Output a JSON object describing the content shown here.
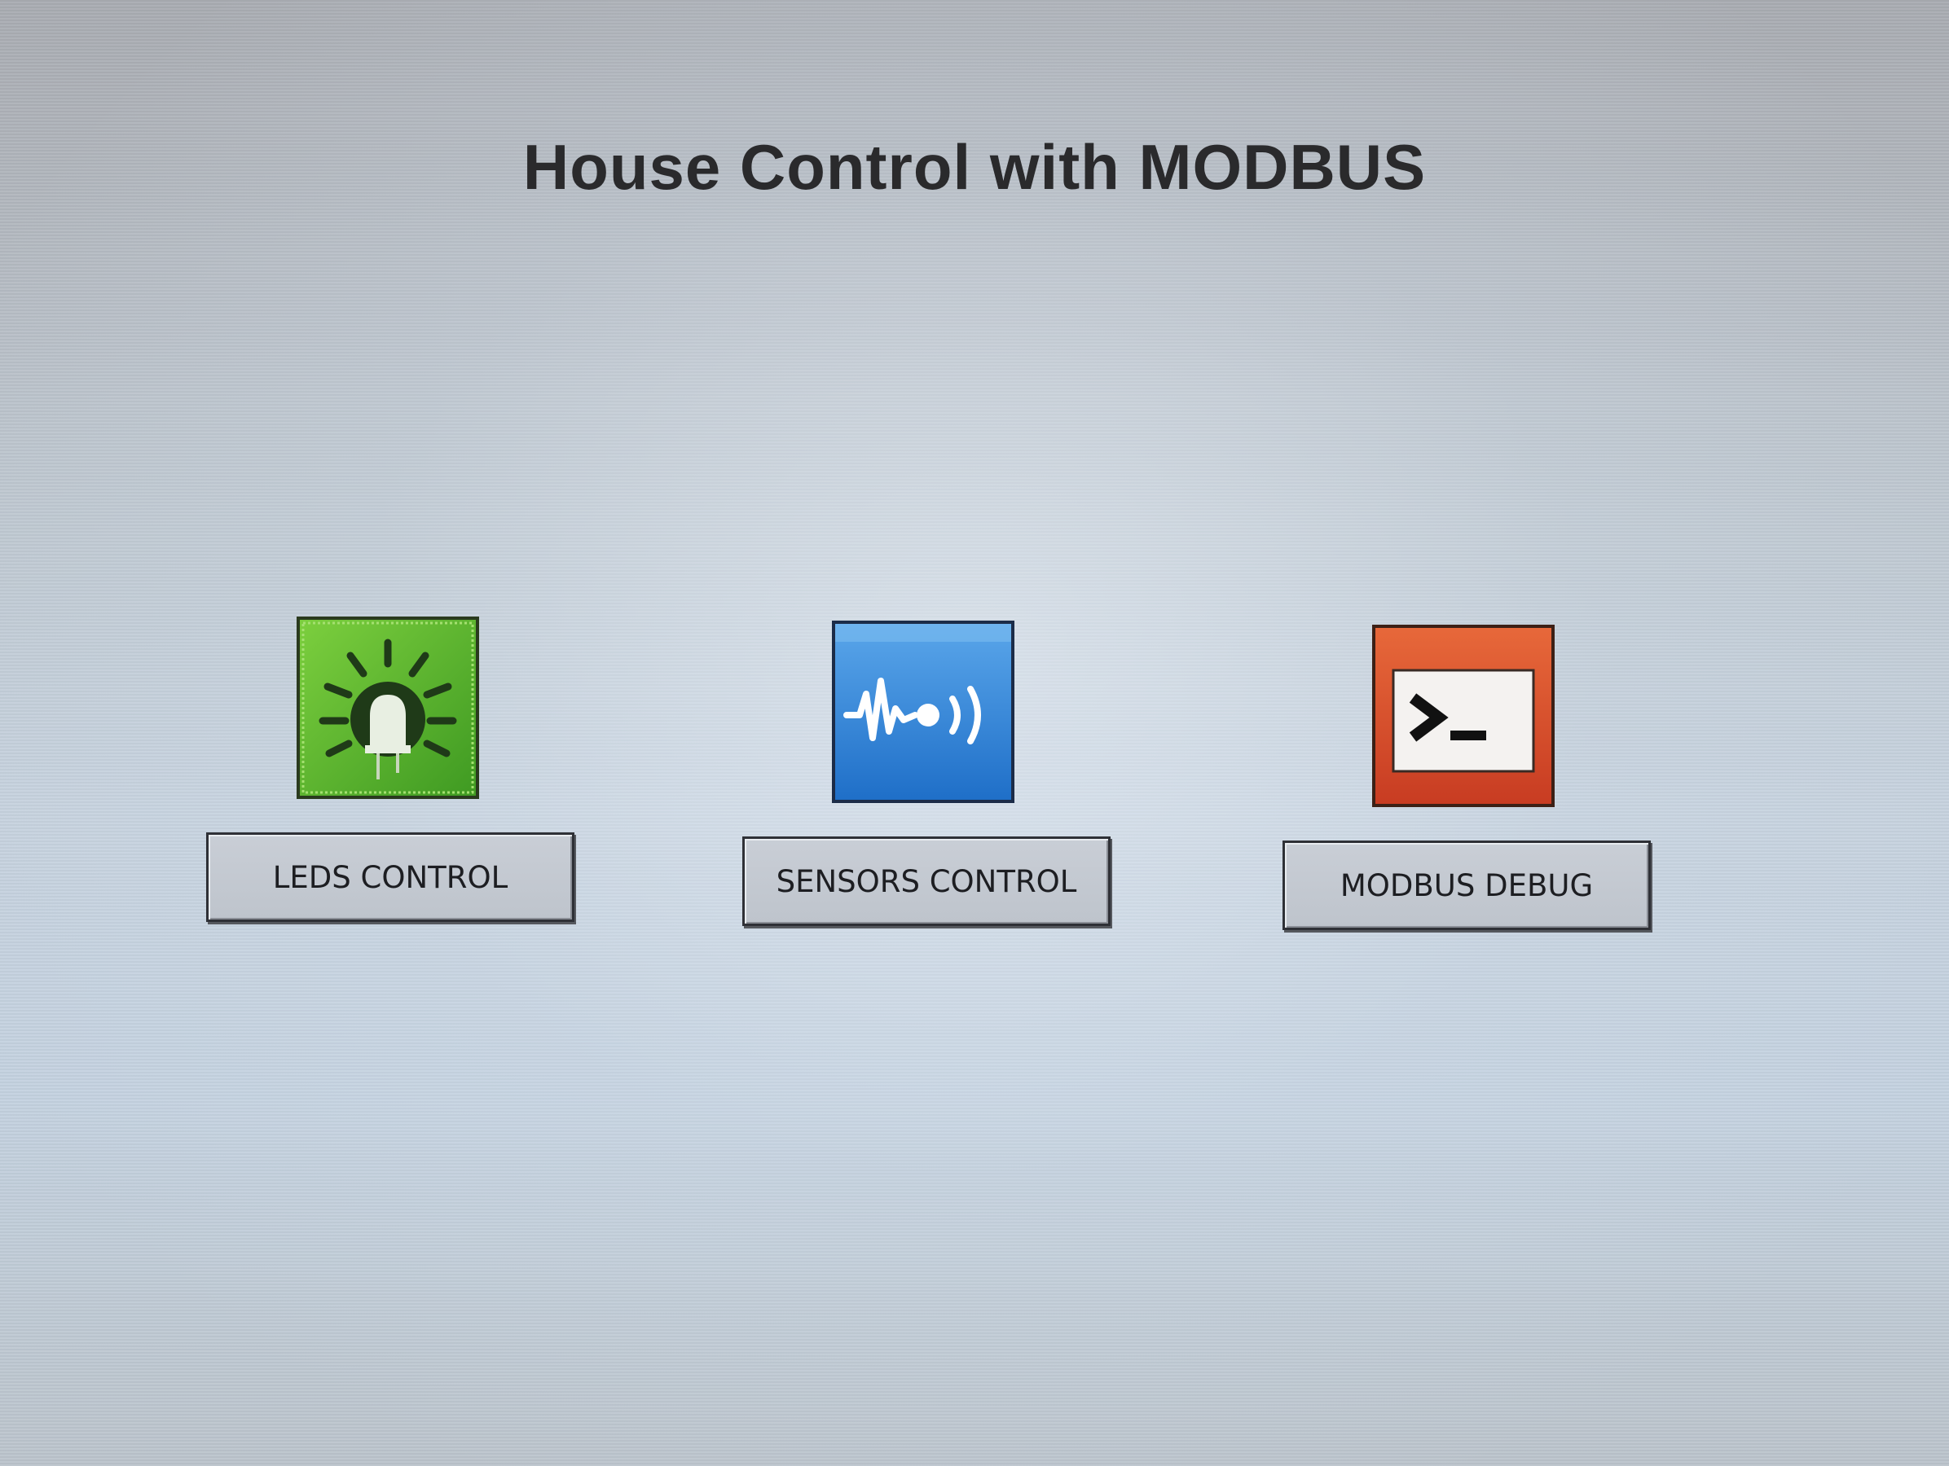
{
  "screen": {
    "title": "House Control with MODBUS"
  },
  "menu": {
    "items": [
      {
        "label": "LEDS CONTROL",
        "icon": "led-beacon-icon",
        "color": "#5cb62e"
      },
      {
        "label": "SENSORS CONTROL",
        "icon": "sensor-wave-icon",
        "color": "#2f86d8"
      },
      {
        "label": "MODBUS DEBUG",
        "icon": "terminal-prompt-icon",
        "color": "#d7512e"
      }
    ]
  },
  "colors": {
    "background": "#c4ccd6",
    "button": "#c4c9d0",
    "title": "#2a2a2c"
  }
}
